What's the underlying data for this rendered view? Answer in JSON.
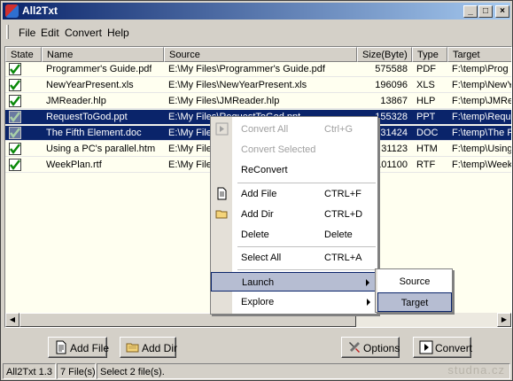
{
  "window": {
    "title": "All2Txt"
  },
  "menubar": {
    "file": "File",
    "edit": "Edit",
    "convert": "Convert",
    "help": "Help"
  },
  "columns": {
    "state": "State",
    "name": "Name",
    "source": "Source",
    "size": "Size(Byte)",
    "type": "Type",
    "target": "Target"
  },
  "rows": [
    {
      "name": "Programmer's Guide.pdf",
      "source": "E:\\My Files\\Programmer's Guide.pdf",
      "size": "575588",
      "type": "PDF",
      "target": "F:\\temp\\Prog"
    },
    {
      "name": "NewYearPresent.xls",
      "source": "E:\\My Files\\NewYearPresent.xls",
      "size": "196096",
      "type": "XLS",
      "target": "F:\\temp\\NewY"
    },
    {
      "name": "JMReader.hlp",
      "source": "E:\\My Files\\JMReader.hlp",
      "size": "13867",
      "type": "HLP",
      "target": "F:\\temp\\JMRe"
    },
    {
      "name": "RequestToGod.ppt",
      "source": "E:\\My Files\\RequestToGod.ppt",
      "size": "155328",
      "type": "PPT",
      "target": "F:\\temp\\Requ"
    },
    {
      "name": "The Fifth Element.doc",
      "source": "E:\\My Files\\The Fifth Element.doc",
      "size": "31424",
      "type": "DOC",
      "target": "F:\\temp\\The F"
    },
    {
      "name": "Using a PC's parallel.htm",
      "source": "E:\\My Files\\Using a PC's parallel.htm",
      "size": "31123",
      "type": "HTM",
      "target": "F:\\temp\\Using"
    },
    {
      "name": "WeekPlan.rtf",
      "source": "E:\\My Files\\WeekPlan.rtf",
      "size": "101100",
      "type": "RTF",
      "target": "F:\\temp\\Week"
    }
  ],
  "context_menu": {
    "convert_all": "Convert All",
    "convert_all_key": "Ctrl+G",
    "convert_selected": "Convert Selected",
    "reconvert": "ReConvert",
    "add_file": "Add File",
    "add_file_key": "CTRL+F",
    "add_dir": "Add Dir",
    "add_dir_key": "CTRL+D",
    "delete": "Delete",
    "delete_key": "Delete",
    "select_all": "Select All",
    "select_all_key": "CTRL+A",
    "launch": "Launch",
    "explore": "Explore"
  },
  "submenu": {
    "source": "Source",
    "target": "Target"
  },
  "buttons": {
    "add_file": "Add File",
    "add_dir": "Add Dir",
    "options": "Options",
    "convert": "Convert"
  },
  "status": {
    "version": "All2Txt 1.3",
    "files": "7 File(s)",
    "selection": "Select 2 file(s)."
  },
  "watermark": "studna.cz",
  "colors": {
    "selection": "#0a246a",
    "menu_hot": "#b6bdd2",
    "title_start": "#0a246a",
    "title_end": "#a6caf0"
  }
}
